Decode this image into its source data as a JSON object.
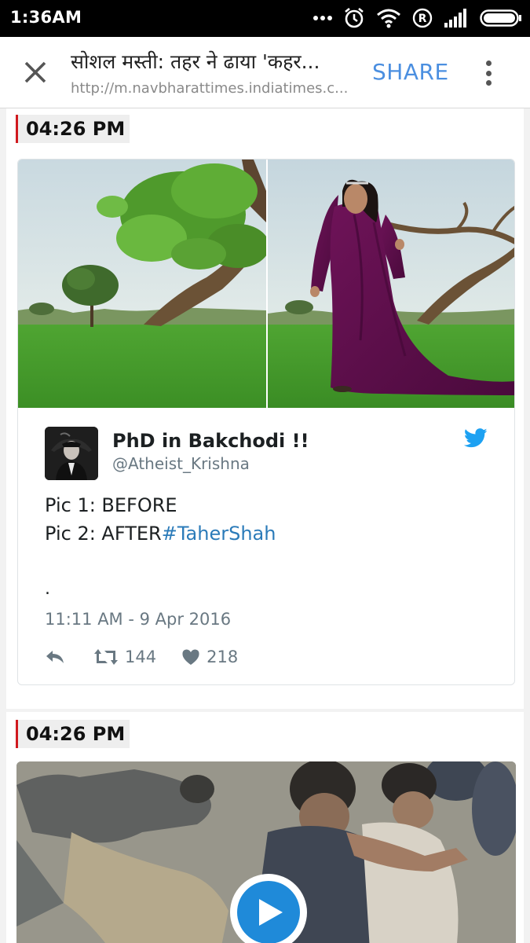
{
  "status_bar": {
    "time": "1:36AM",
    "icons": [
      "more-dots-icon",
      "alarm-icon",
      "wifi-icon",
      "registered-icon",
      "signal-icon",
      "battery-icon"
    ]
  },
  "browser": {
    "title": "सोशल मस्ती: तहर ने ढाया 'कहर...",
    "url": "http://m.navbharattimes.indiatimes.c...",
    "share_label": "SHARE",
    "accent_color": "#4b8fe0"
  },
  "entries": [
    {
      "time": "04:26 PM",
      "tweet": {
        "author_name": "PhD in Bakchodi !!",
        "handle": "@Atheist_Krishna",
        "text_line1": "Pic 1: BEFORE",
        "text_line2_prefix": "Pic 2: AFTER",
        "hashtag": "#TaherShah",
        "trailing": ".",
        "date": "11:11 AM - 9 Apr 2016",
        "retweets": "144",
        "likes": "218"
      }
    },
    {
      "time": "04:26 PM"
    }
  ],
  "colors": {
    "time_marker": "#d0191f",
    "twitter_blue": "#1da1f2",
    "hashtag": "#2b7bb9",
    "play_button": "#1f8ad9"
  }
}
